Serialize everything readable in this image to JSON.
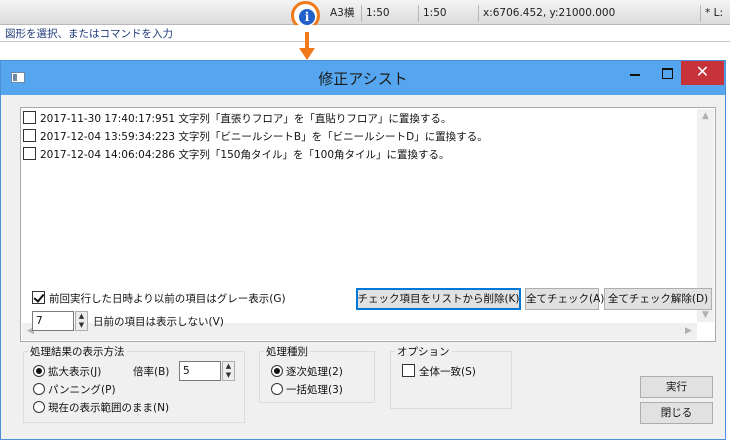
{
  "statusbar": {
    "info_icon": "info-icon",
    "paper": "A3横",
    "scale1": "1:50",
    "scale2": "1:50",
    "coords": "x:6706.452, y:21000.000",
    "right_marker": "*",
    "right_text": "L:"
  },
  "command_prompt": "図形を選択、またはコマンドを入力",
  "dialog": {
    "title": "修正アシスト",
    "close_symbol": "✕"
  },
  "log": {
    "rows": [
      {
        "checked": false,
        "text": "2017-11-30 17:40:17:951  文字列「直張りフロア」を「直貼りフロア」に置換する。"
      },
      {
        "checked": false,
        "text": "2017-12-04 13:59:34:223  文字列「ビニールシートB」を「ビニールシートD」に置換する。"
      },
      {
        "checked": false,
        "text": "2017-12-04 14:06:04:286  文字列「150角タイル」を「100角タイル」に置換する。"
      }
    ]
  },
  "options_row": {
    "gray_checkbox_label": "前回実行した日時より以前の項目はグレー表示(G)",
    "gray_checked": true,
    "days_value": "7",
    "days_label": "日前の項目は表示しない(V)"
  },
  "buttons": {
    "remove_checked": "チェック項目をリストから削除(K)",
    "check_all": "全てチェック(A)",
    "uncheck_all": "全てチェック解除(D)",
    "run": "実行",
    "close": "閉じる"
  },
  "display_group": {
    "title": "処理結果の表示方法",
    "zoom_label": "拡大表示(J)",
    "zoom_selected": true,
    "ratio_label": "倍率(B)",
    "ratio_value": "5",
    "pan_label": "パンニング(P)",
    "keep_label": "現在の表示範囲のまま(N)"
  },
  "process_group": {
    "title": "処理種別",
    "sequential_label": "逐次処理(2)",
    "sequential_selected": true,
    "batch_label": "一括処理(3)"
  },
  "option_group": {
    "title": "オプション",
    "exact_label": "全体一致(S)",
    "exact_checked": false
  }
}
